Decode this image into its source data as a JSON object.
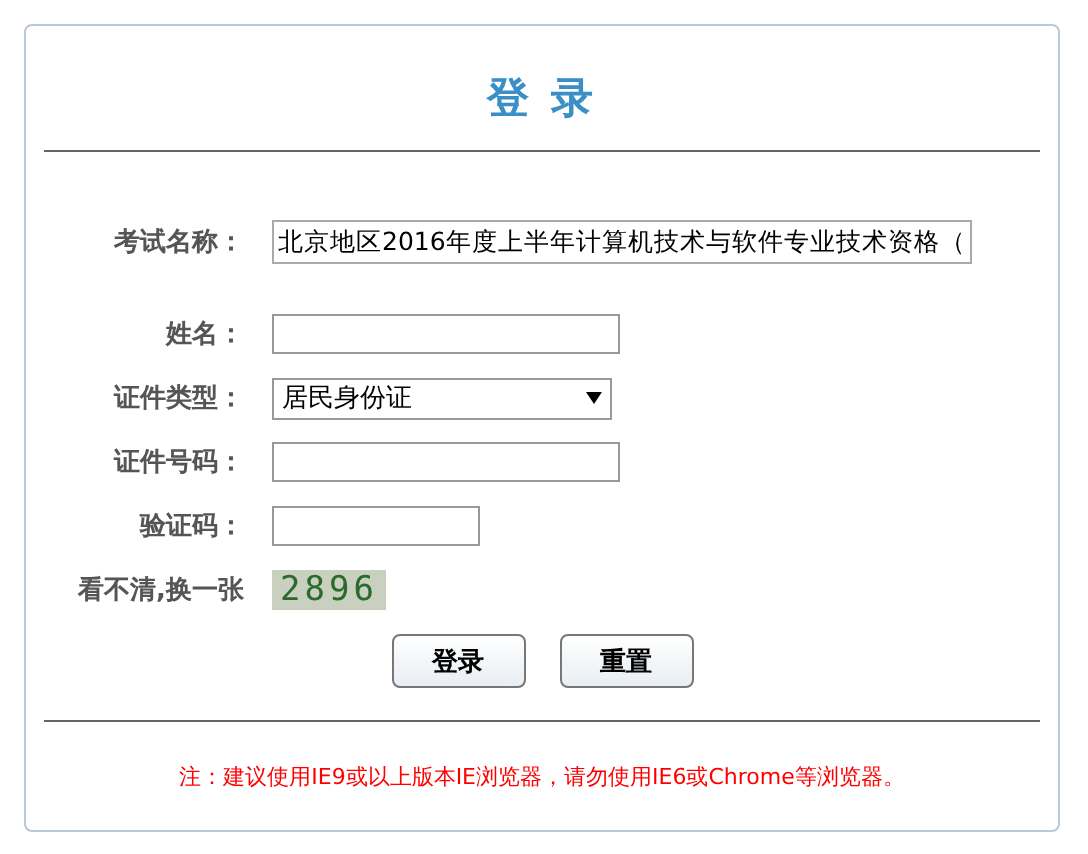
{
  "title": "登 录",
  "fields": [
    {
      "kind": "text",
      "label": "考试名称：",
      "value": "北京地区2016年度上半年计算机技术与软件专业技术资格（"
    },
    {
      "kind": "input",
      "label": "姓名："
    },
    {
      "kind": "select",
      "label": "证件类型：",
      "value": "居民身份证"
    },
    {
      "kind": "input",
      "label": "证件号码："
    },
    {
      "kind": "captcha-input",
      "label": "验证码："
    },
    {
      "kind": "captcha",
      "label": "看不清,换一张",
      "value": "2896"
    }
  ],
  "buttons": [
    "登录",
    "重置"
  ],
  "note": "注：建议使用IE9或以上版本IE浏览器，请勿使用IE6或Chrome等浏览器。"
}
